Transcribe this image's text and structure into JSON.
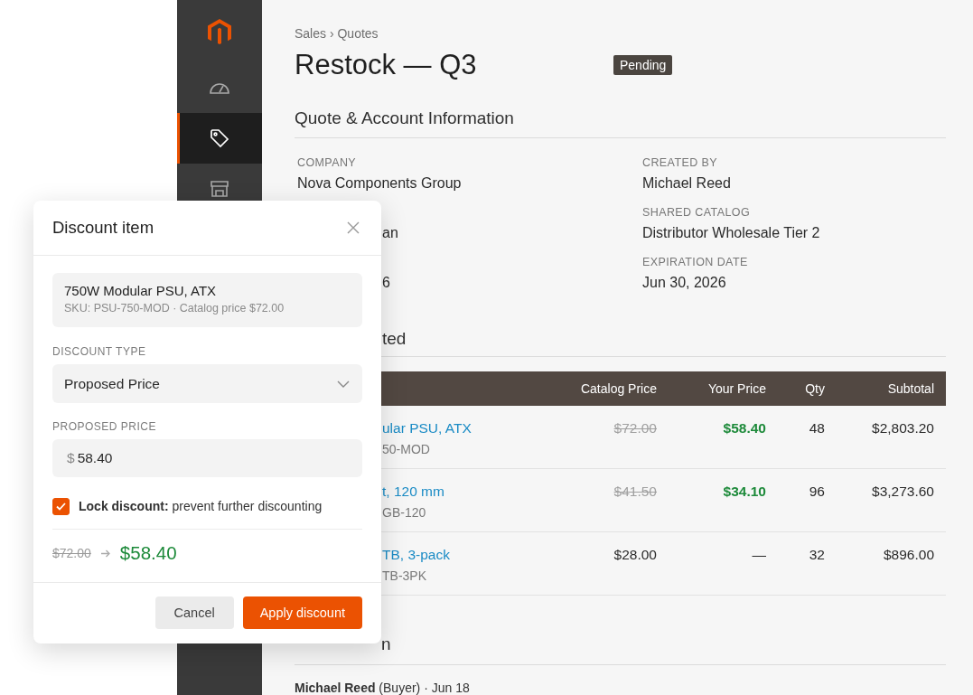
{
  "sidebar": {
    "items": [
      {
        "selected": false
      },
      {
        "selected": true
      },
      {
        "selected": false
      }
    ]
  },
  "breadcrumb": "Sales › Quotes",
  "title": "Restock — Q3",
  "status_badge": "Pending",
  "info_section": {
    "heading": "Quote & Account Information",
    "columns": [
      [
        {
          "label": "COMPANY",
          "value": "Nova Components Group"
        },
        {
          "value": "an"
        },
        {
          "value": "6"
        }
      ],
      [
        {
          "label": "CREATED BY",
          "value": "Michael Reed"
        },
        {
          "label": "SHARED CATALOG",
          "value": "Distributor Wholesale Tier 2"
        },
        {
          "label": "EXPIRATION DATE",
          "value": "Jun 30, 2026"
        }
      ]
    ]
  },
  "items_section": {
    "heading": "ted",
    "table": {
      "columns": [
        "Catalog Price",
        "Your Price",
        "Qty",
        "Subtotal"
      ],
      "rows": [
        {
          "name": "ular PSU, ATX",
          "sku": "50-MOD",
          "catalog_price": "$72.00",
          "your_price": "$58.40",
          "discounted": true,
          "qty": "48",
          "subtotal": "$2,803.20"
        },
        {
          "name": "t, 120 mm",
          "sku": "GB-120",
          "catalog_price": "$41.50",
          "your_price": "$34.10",
          "discounted": true,
          "qty": "96",
          "subtotal": "$3,273.60"
        },
        {
          "name": "TB, 3-pack",
          "sku": "TB-3PK",
          "catalog_price": "$28.00",
          "your_price": "—",
          "discounted": false,
          "qty": "32",
          "subtotal": "$896.00"
        }
      ]
    }
  },
  "negotiation": {
    "heading": "n",
    "comment": "**Michael Reed** (Buyer) · Jun 18"
  },
  "dialog": {
    "title": "Discount item",
    "product": {
      "name": "750W Modular PSU, ATX",
      "meta": "SKU: PSU-750-MOD · Catalog price $72.00"
    },
    "discount_type": {
      "label": "DISCOUNT TYPE",
      "value": "Proposed Price"
    },
    "proposed_price": {
      "label": "PROPOSED PRICE",
      "prefix": "$",
      "value": "58.40"
    },
    "lock": {
      "checked": true,
      "text": "**Lock discount:** prevent further discounting"
    },
    "old_price": "$72.00",
    "new_price": "$58.40",
    "buttons": {
      "cancel": "Cancel",
      "apply": "Apply discount"
    }
  }
}
